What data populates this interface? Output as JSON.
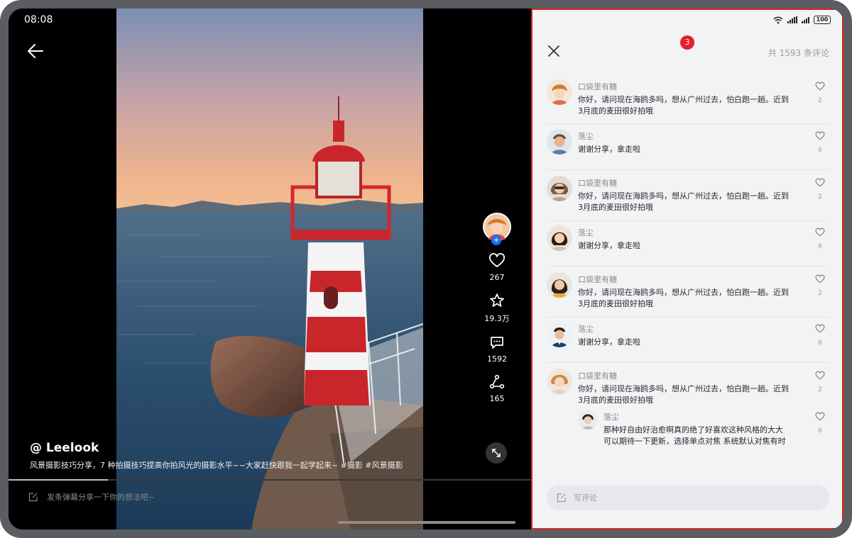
{
  "status_bar": {
    "time": "08:08",
    "battery": "100"
  },
  "video": {
    "author_handle": "@ Leelook",
    "description": "风景摄影技巧分享，7 种拍摄技巧提高你拍风光的摄影水平~~大家赶快跟我一起学起来~ #摄影 #风景摄影",
    "progress_fraction": 0.19,
    "likes": "267",
    "favorites": "19.3万",
    "comments": "1592",
    "shares": "165",
    "danmaku_placeholder": "发条弹幕分享一下你的想法吧~"
  },
  "comments_panel": {
    "badge": "3",
    "total_label": "共 1593 条评论",
    "items": [
      {
        "user": "口袋里有糖",
        "text": "你好，请问现在海鸥多吗，想从广州过去，怕白跑一趟。近到3月底的麦田很好拍哦",
        "likes": "2"
      },
      {
        "user": "落尘",
        "text": "谢谢分享，拿走啦",
        "likes": "6"
      },
      {
        "user": "口袋里有糖",
        "text": "你好，请问现在海鸥多吗，想从广州过去，怕白跑一趟。近到3月底的麦田很好拍哦",
        "likes": "2"
      },
      {
        "user": "落尘",
        "text": "谢谢分享，拿走啦",
        "likes": "6"
      },
      {
        "user": "口袋里有糖",
        "text": "你好，请问现在海鸥多吗，想从广州过去，怕白跑一趟。近到3月底的麦田很好拍哦",
        "likes": "2"
      },
      {
        "user": "落尘",
        "text": "谢谢分享，拿走啦",
        "likes": "6"
      },
      {
        "user": "口袋里有糖",
        "text": "你好，请问现在海鸥多吗，想从广州过去，怕白跑一趟。近到3月底的麦田很好拍哦",
        "likes": "2"
      }
    ],
    "reply": {
      "user": "落尘",
      "text": "那种好自由好治愈啊真的绝了好喜欢这种风格的大大可以期待一下更新，选择单点对焦 系统默认对焦有时",
      "likes": "6"
    },
    "write_placeholder": "写评论"
  },
  "colors": {
    "accent_red": "#e5202a",
    "follow_blue": "#1e6bff",
    "panel_bg": "#f1f3f5"
  },
  "icons": [
    "back-arrow-icon",
    "heart-icon",
    "star-icon",
    "comment-bubble-icon",
    "share-icon",
    "expand-icon",
    "edit-icon",
    "close-icon",
    "wifi-icon",
    "signal-icon",
    "battery-icon"
  ]
}
